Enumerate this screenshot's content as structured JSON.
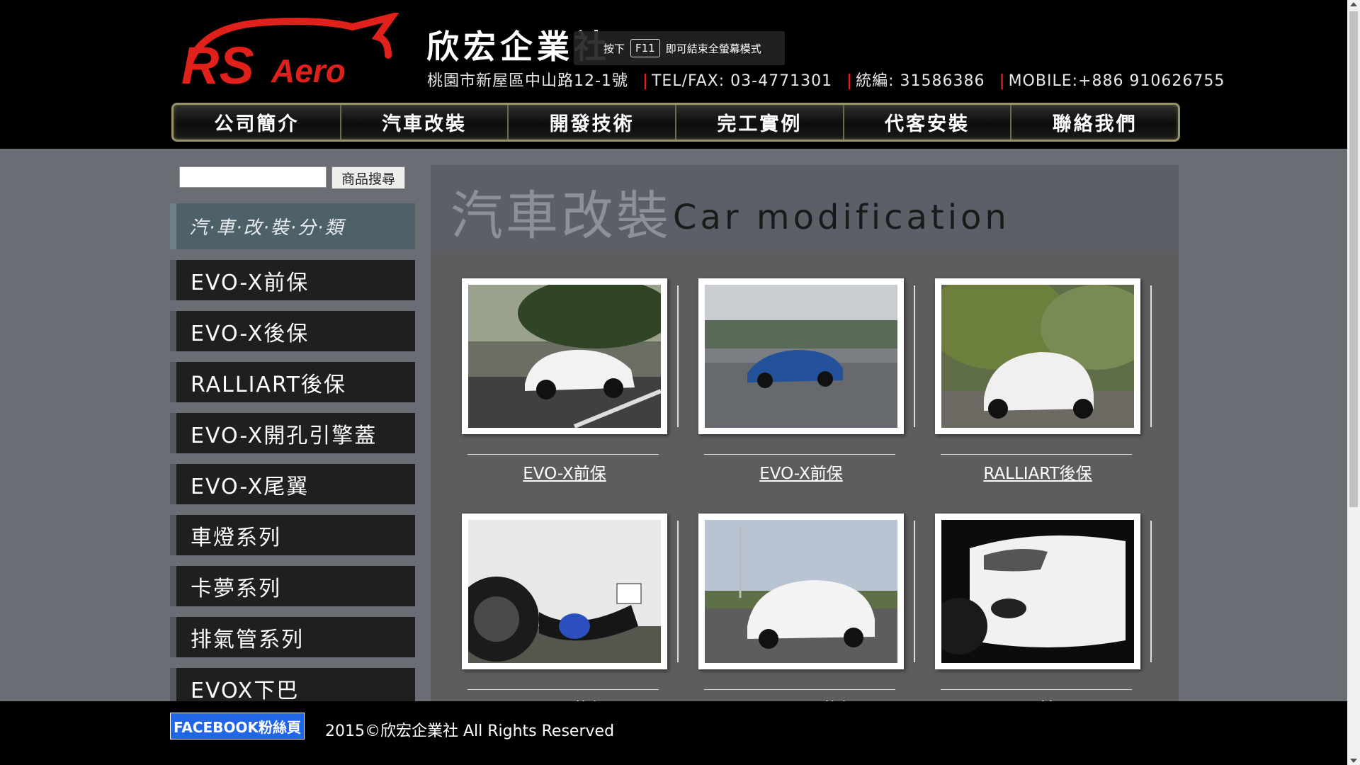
{
  "header": {
    "logo_text": "RS Aero",
    "company_name": "欣宏企業社",
    "address": "桃園市新屋區中山路12-1號",
    "tel": "TEL/FAX: 03-4771301",
    "tax_id": "統編: 31586386",
    "mobile": "MOBILE:+886 910626755",
    "fullscreen_tip_before": "按下",
    "fullscreen_tip_key": "F11",
    "fullscreen_tip_after": "即可結束全螢幕模式"
  },
  "nav": {
    "items": [
      "公司簡介",
      "汽車改裝",
      "開發技術",
      "完工實例",
      "代客安裝",
      "聯絡我們"
    ]
  },
  "sidebar": {
    "search_placeholder": "",
    "search_button": "商品搜尋",
    "category_header": "汽·車·改·裝·分·類",
    "items": [
      "EVO-X前保",
      "EVO-X後保",
      "RALLIART後保",
      "EVO-X開孔引擎蓋",
      "EVO-X尾翼",
      "車燈系列",
      "卡夢系列",
      "排氣管系列",
      "EVOX下巴"
    ]
  },
  "main": {
    "title_zh": "汽車改裝",
    "title_en": "Car modification",
    "products": [
      {
        "caption": "EVO-X前保",
        "image": "white-evo-front"
      },
      {
        "caption": "EVO-X前保",
        "image": "blue-evo-road"
      },
      {
        "caption": "RALLIART後保",
        "image": "white-ralliart-rear"
      },
      {
        "caption": "EVO-X後保",
        "image": "exhaust-closeup"
      },
      {
        "caption": "RALLIART後保",
        "image": "white-ralliart-side"
      },
      {
        "caption": "EVO-X前下巴",
        "image": "front-lip-closeup"
      }
    ]
  },
  "footer": {
    "facebook": "FACEBOOK粉絲頁",
    "copyright": "2015©欣宏企業社 All Rights Reserved"
  },
  "colors": {
    "brand_red": "#e0201a",
    "background": "#6b6d74",
    "facebook_blue": "#2166e6"
  }
}
